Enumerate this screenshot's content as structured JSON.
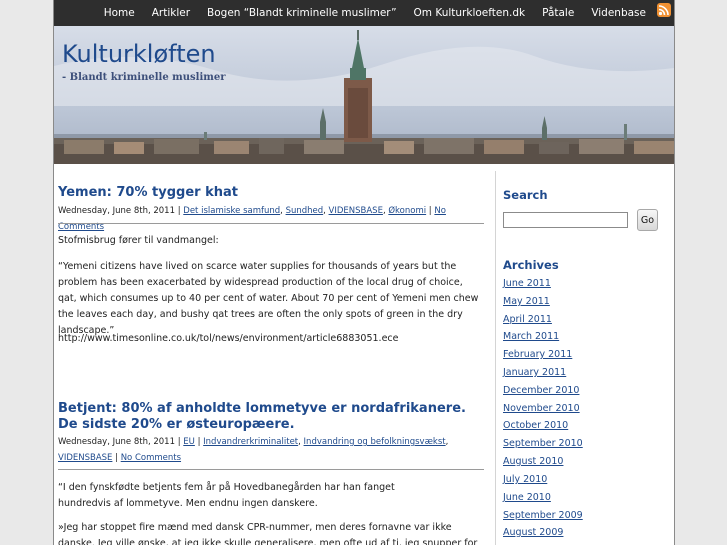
{
  "nav": {
    "items": [
      "Home",
      "Artikler",
      "Bogen “Blandt kriminelle muslimer”",
      "Om Kulturkloeften.dk",
      "Påtale",
      "Videnbase"
    ]
  },
  "header": {
    "title": "Kulturkløften",
    "tagline": "- Blandt kriminelle muslimer"
  },
  "posts": [
    {
      "title": "Yemen: 70% tygger khat",
      "date": "Wednesday, June 8th, 2011",
      "categories": [
        "Det islamiske samfund",
        "Sundhed",
        "VIDENSBASE",
        "Økonomi"
      ],
      "comments": "No Comments",
      "paragraphs": [
        "Stofmisbrug fører til vandmangel:",
        "“Yemeni citizens have lived on scarce water supplies for thousands of years but the problem has been exacerbated by widespread production of the local drug of choice, qat, which consumes up to 40 per cent of water. About 70 per cent of Yemeni men chew the leaves each day, and bushy qat trees are often the only spots of green in the dry landscape.”",
        "http://www.timesonline.co.uk/tol/news/environment/article6883051.ece"
      ]
    },
    {
      "title": "Betjent: 80% af anholdte lommetyve er nordafrikanere. De sidste 20% er østeuropæere.",
      "date": "Wednesday, June 8th, 2011",
      "categories": [
        "EU",
        "Indvandrerkriminalitet",
        "Indvandring og befolkningsvækst",
        "VIDENSBASE"
      ],
      "comments": "No Comments",
      "paragraphs": [
        "“I den fynskfødte betjents fem år på Hovedbanegården har han fanget hundredvis af lommetyve. Men endnu ingen danskere.",
        "»Jeg har stoppet fire mænd med dansk CPR-nummer, men deres fornavne var ikke danske. Jeg ville ønske, at jeg ikke skulle generalisere, men ofte ud af ti, jeg snupper for tiden, er"
      ]
    }
  ],
  "sidebar": {
    "search_heading": "Search",
    "search_button": "Go",
    "archives_heading": "Archives",
    "archives": [
      "June 2011",
      "May 2011",
      "April 2011",
      "March 2011",
      "February 2011",
      "January 2011",
      "December 2010",
      "November 2010",
      "October 2010",
      "September 2010",
      "August 2010",
      "July 2010",
      "June 2010",
      "September 2009",
      "August 2009"
    ]
  },
  "colors": {
    "link": "#1f4a8c",
    "nav_bg": "#2e2e2e",
    "rss": "#f09133"
  }
}
